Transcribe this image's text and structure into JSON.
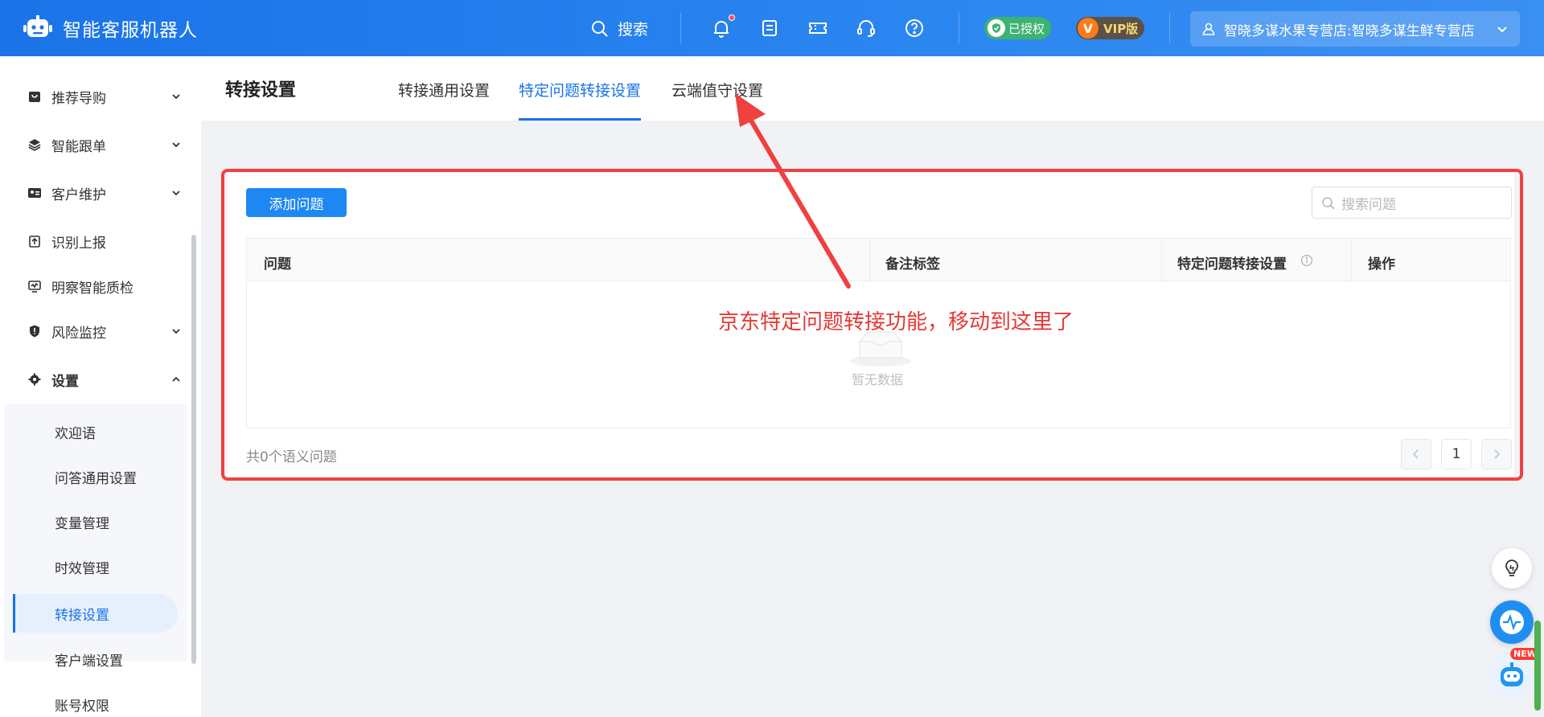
{
  "header": {
    "brand": "智能客服机器人",
    "search_label": "搜索",
    "auth_badge": "已授权",
    "vip_badge": "VIP版",
    "vip_letter": "V",
    "store": "智晓多谋水果专营店:智晓多谋生鲜专营店"
  },
  "sidebar": {
    "items": [
      {
        "label": "推荐导购",
        "icon": "bag-icon",
        "expandable": true
      },
      {
        "label": "智能跟单",
        "icon": "layers-icon",
        "expandable": true
      },
      {
        "label": "客户维护",
        "icon": "id-card-icon",
        "expandable": true
      },
      {
        "label": "识别上报",
        "icon": "upload-icon",
        "expandable": false
      },
      {
        "label": "明察智能质检",
        "icon": "monitor-icon",
        "expandable": false
      },
      {
        "label": "风险监控",
        "icon": "shield-icon",
        "expandable": true
      },
      {
        "label": "设置",
        "icon": "gear-icon",
        "expandable": true
      }
    ],
    "settings_sub": [
      {
        "label": "欢迎语"
      },
      {
        "label": "问答通用设置"
      },
      {
        "label": "变量管理"
      },
      {
        "label": "时效管理"
      },
      {
        "label": "转接设置"
      },
      {
        "label": "客户端设置"
      },
      {
        "label": "账号权限"
      }
    ],
    "active_sub": "转接设置"
  },
  "page": {
    "title": "转接设置",
    "tabs": [
      {
        "label": "转接通用设置"
      },
      {
        "label": "特定问题转接设置"
      },
      {
        "label": "云端值守设置"
      }
    ],
    "active_tab": "特定问题转接设置"
  },
  "panel": {
    "add_button": "添加问题",
    "search_placeholder": "搜索问题",
    "columns": [
      "问题",
      "备注标签",
      "特定问题转接设置",
      "操作"
    ],
    "empty_text": "暂无数据",
    "total_text": "共0个语义问题",
    "current_page": "1"
  },
  "annotation": {
    "text": "京东特定问题转接功能，移动到这里了",
    "color": "#e53935"
  },
  "colors": {
    "primary": "#1a73e8",
    "button": "#1e88f2",
    "annotation": "#f04040"
  },
  "floating": {
    "new_tag": "NEW"
  }
}
